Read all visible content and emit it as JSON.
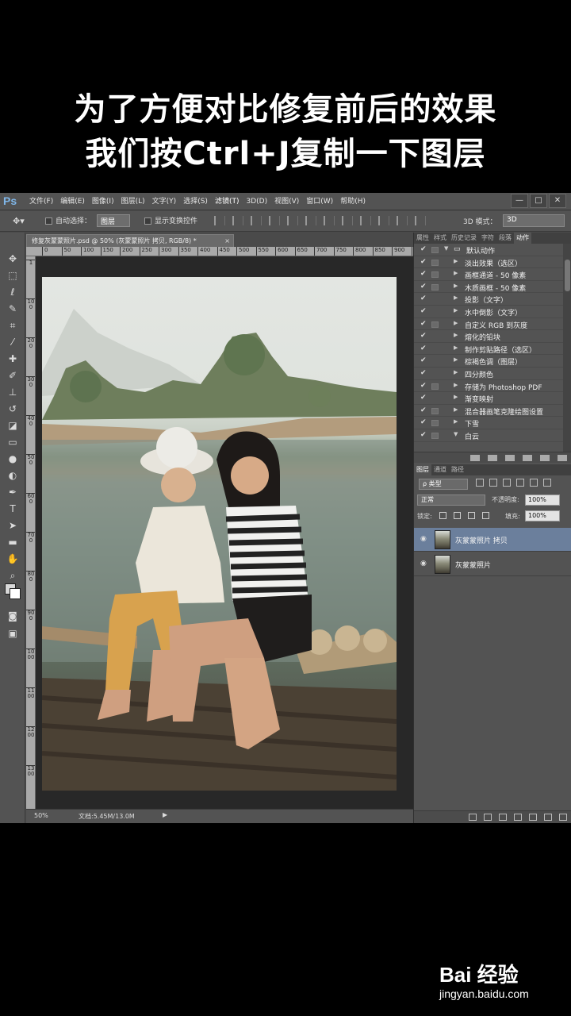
{
  "caption": {
    "line1": "为了方便对比修复前后的效果",
    "line2": "我们按Ctrl+J复制一下图层"
  },
  "app": {
    "logo": "Ps",
    "menu": [
      "文件(F)",
      "编辑(E)",
      "图像(I)",
      "图层(L)",
      "文字(Y)",
      "选择(S)",
      "滤镜(T)",
      "3D(D)",
      "视图(V)",
      "窗口(W)",
      "帮助(H)"
    ],
    "window_controls": [
      "—",
      "□",
      "✕"
    ]
  },
  "options": {
    "auto_select_label": "自动选择：",
    "auto_select_value": "图层",
    "show_transform_label": "显示变换控件",
    "mode3d_label": "3D 模式：",
    "mode3d_value": "3D"
  },
  "document": {
    "tab_title": "修复灰蒙蒙照片.psd @ 50% (灰蒙蒙照片 拷贝, RGB/8) *",
    "tab_close": "×",
    "ruler_h": [
      "0",
      "50",
      "100",
      "150",
      "200",
      "250",
      "300",
      "350",
      "400",
      "450",
      "500",
      "550",
      "600",
      "650",
      "700",
      "750",
      "800",
      "850",
      "900",
      "950",
      "1000",
      "1050",
      "1100"
    ],
    "ruler_v": [
      "1",
      "100",
      "200",
      "300",
      "400",
      "500",
      "600",
      "700",
      "800",
      "900",
      "1000",
      "1100",
      "1200",
      "1300"
    ],
    "zoom": "50%",
    "doc_size": "文档:5.45M/13.0M",
    "status_arrow": "▶"
  },
  "actions_panel": {
    "tabs": [
      "属性",
      "样式",
      "历史记录",
      "字符",
      "段落",
      "动作"
    ],
    "active_tab": "动作",
    "set_name": "默认动作",
    "items": [
      "淡出效果（选区）",
      "画框通道 - 50 像素",
      "木质画框 - 50 像素",
      "投影（文字）",
      "水中倒影（文字）",
      "自定义 RGB 到灰度",
      "熔化的铅块",
      "制作剪贴路径（选区）",
      "棕褐色调（图层）",
      "四分颜色",
      "存储为 Photoshop PDF",
      "渐变映射",
      "混合器画笔克隆绘图设置",
      "下雪",
      "白云"
    ]
  },
  "layers_panel": {
    "tabs": [
      "图层",
      "通道",
      "路径"
    ],
    "active_tab": "图层",
    "filter_value": "ρ 类型",
    "blend_mode": "正常",
    "opacity_label": "不透明度:",
    "opacity_value": "100%",
    "lock_label": "锁定:",
    "fill_label": "填充:",
    "fill_value": "100%",
    "layers": [
      {
        "name": "灰蒙蒙照片 拷贝",
        "selected": true
      },
      {
        "name": "灰蒙蒙照片",
        "selected": false
      }
    ]
  },
  "watermark": {
    "brand": "Bai 经验",
    "url": "jingyan.baidu.com"
  },
  "colors": {
    "selected_layer": "#6b7f9c",
    "panel_bg": "#535353",
    "canvas_bg": "#282828"
  }
}
